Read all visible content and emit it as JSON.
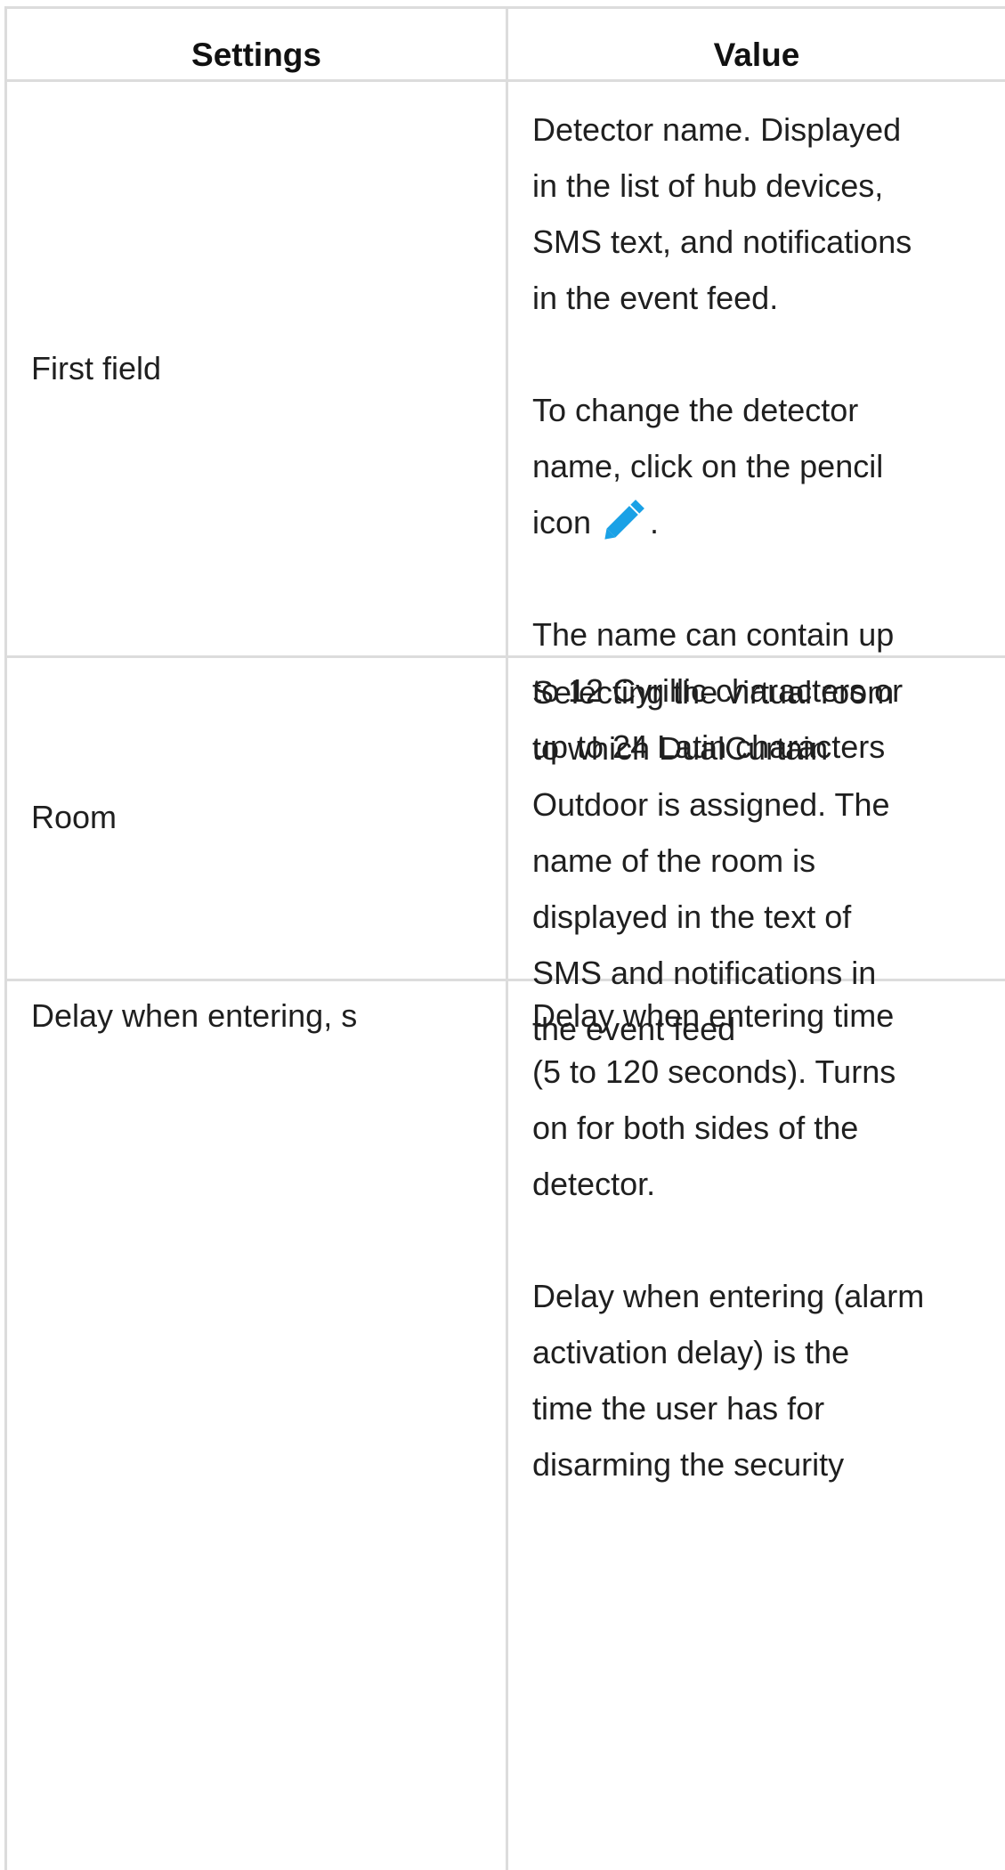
{
  "table": {
    "headers": {
      "settings": "Settings",
      "value": "Value"
    },
    "rows": [
      {
        "setting": "First field",
        "value": {
          "p1": "Detector name. Displayed\nin the list of hub devices,\nSMS text, and notifications\nin the event feed.",
          "p2_before_icon": "To change the detector\nname, click on the pencil\nicon",
          "p2_after_icon": ".",
          "p3": "The name can contain up\nto 12 Cyrillic characters or\nup to 24 Latin characters"
        }
      },
      {
        "setting": "Room",
        "value": {
          "p1": "Selecting the virtual room\nto which DualCurtain\nOutdoor is assigned. The\nname of the room is\ndisplayed in the text of\nSMS and notifications in\nthe event feed"
        }
      },
      {
        "setting": "Delay when entering, s",
        "value": {
          "p1": "Delay when entering time\n(5 to 120 seconds). Turns\non for both sides of the\ndetector.",
          "p2": "Delay when entering (alarm\nactivation delay) is the\ntime the user has for\ndisarming the security"
        }
      }
    ]
  },
  "icons": {
    "pencil": "pencil-icon",
    "pencil_color": "#1aa1e6"
  },
  "colors": {
    "border": "#dcdcdc",
    "text": "#1f1f1f",
    "background": "#ffffff"
  }
}
